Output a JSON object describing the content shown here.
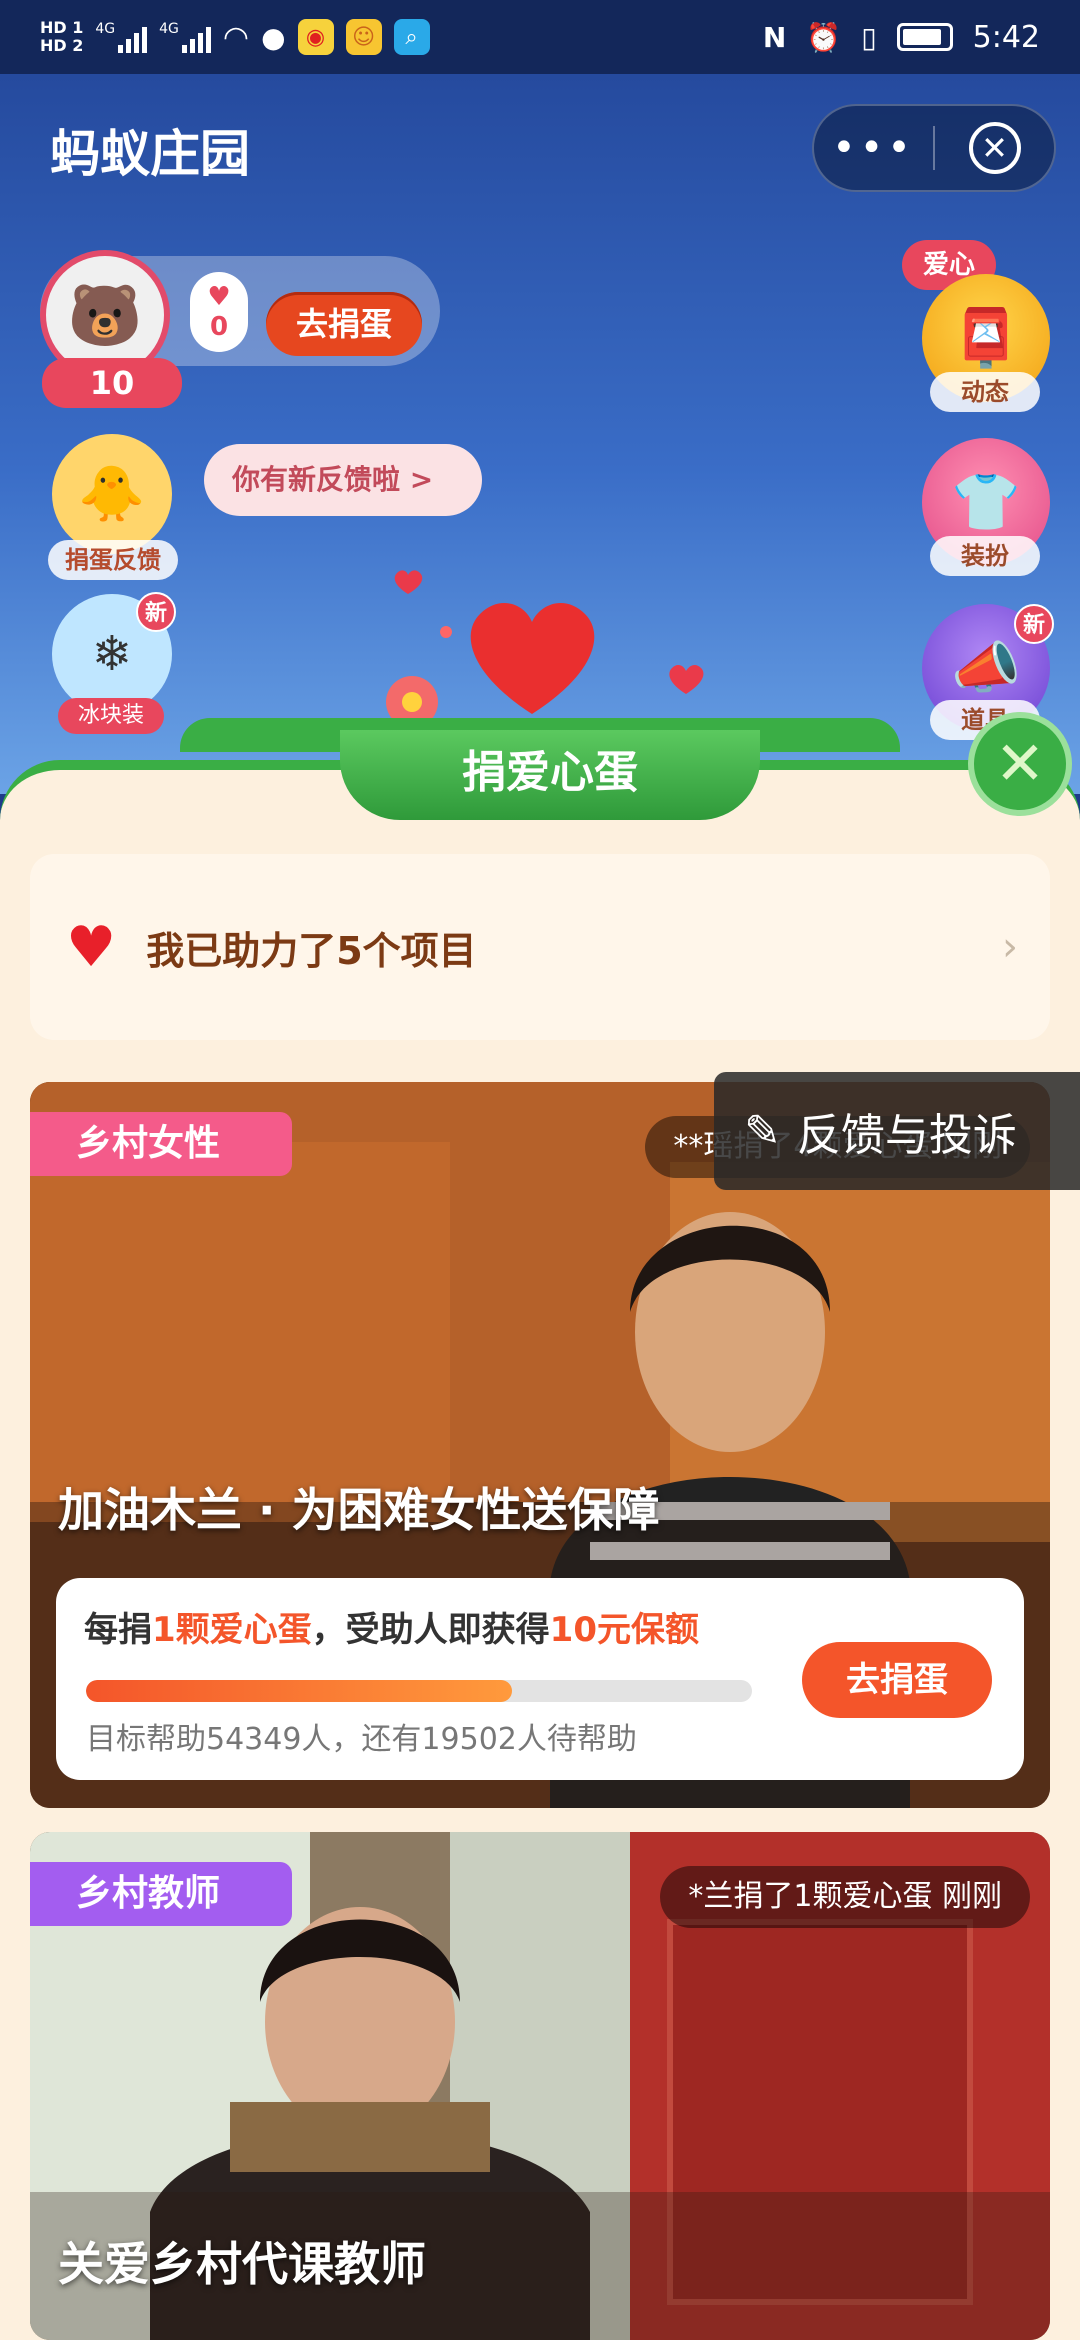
{
  "status_bar": {
    "hd1": "HD 1",
    "hd2": "HD 2",
    "net1": "4G",
    "net2": "4G",
    "time": "5:42"
  },
  "header": {
    "title": "蚂蚁庄园",
    "more_icon": "more-dots-icon",
    "close_icon": "close-circle-icon"
  },
  "scene": {
    "level": "10",
    "heart_count": "0",
    "go_donate_label": "去捐蛋",
    "feedback_bubble": "你有新反馈啦 >",
    "feedback_label": "捐蛋反馈",
    "ice_label": "冰块装",
    "new_badge": "新",
    "love_tag": "爱心",
    "right_buttons": [
      {
        "label": "动态"
      },
      {
        "label": "装扮"
      },
      {
        "label": "道具"
      }
    ]
  },
  "panel": {
    "banner": "捐爱心蛋",
    "helped_text": "我已助力了5个项目"
  },
  "complaint": {
    "label": "反馈与投诉"
  },
  "cards": [
    {
      "tag": "乡村女性",
      "ticker": "**瑶捐了4颗爱心蛋 刚刚",
      "title": "加油木兰 · 为困难女性送保障",
      "line1_pre": "每捐",
      "line1_em1": "1颗爱心蛋",
      "line1_mid": "，受助人即获得",
      "line1_em2": "10元保额",
      "progress": 0.64,
      "line2": "目标帮助54349人，还有19502人待帮助",
      "button": "去捐蛋"
    },
    {
      "tag": "乡村教师",
      "ticker": "*兰捐了1颗爱心蛋 刚刚",
      "title": "关爱乡村代课教师"
    }
  ],
  "colors": {
    "accent_orange": "#f4552a",
    "panel_bg": "#fdf0de",
    "green": "#3aae45"
  }
}
